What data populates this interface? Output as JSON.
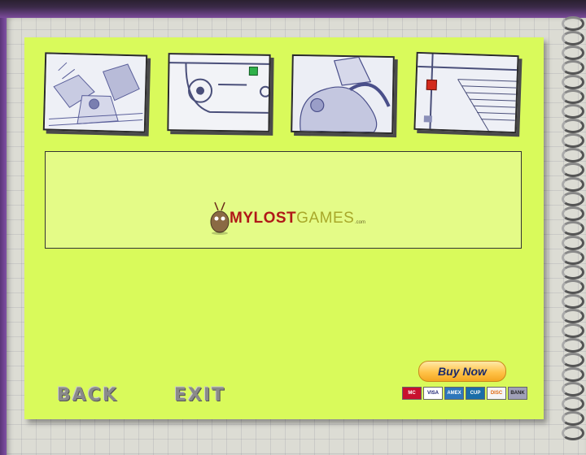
{
  "buttons": {
    "back_label": "BACK",
    "exit_label": "EXIT",
    "buy_label": "Buy Now"
  },
  "logo": {
    "part1": "MYLOST",
    "part2": "GAMES",
    "suffix": ".com"
  },
  "payment_cards": [
    "MasterCard",
    "VISA",
    "AMEX",
    "ChinaPay",
    "DISCOVER",
    "BANK"
  ],
  "colors": {
    "panel": "#d9fa5b",
    "ad_box": "#e4fb87",
    "buy_button": "#ffc349",
    "logo_red": "#b01818",
    "logo_olive": "#a8a82a"
  },
  "thumbnails": [
    {
      "name": "robot-scene"
    },
    {
      "name": "track-scene",
      "marker": "green"
    },
    {
      "name": "creature-scene"
    },
    {
      "name": "pyramid-scene",
      "marker": "red"
    }
  ]
}
